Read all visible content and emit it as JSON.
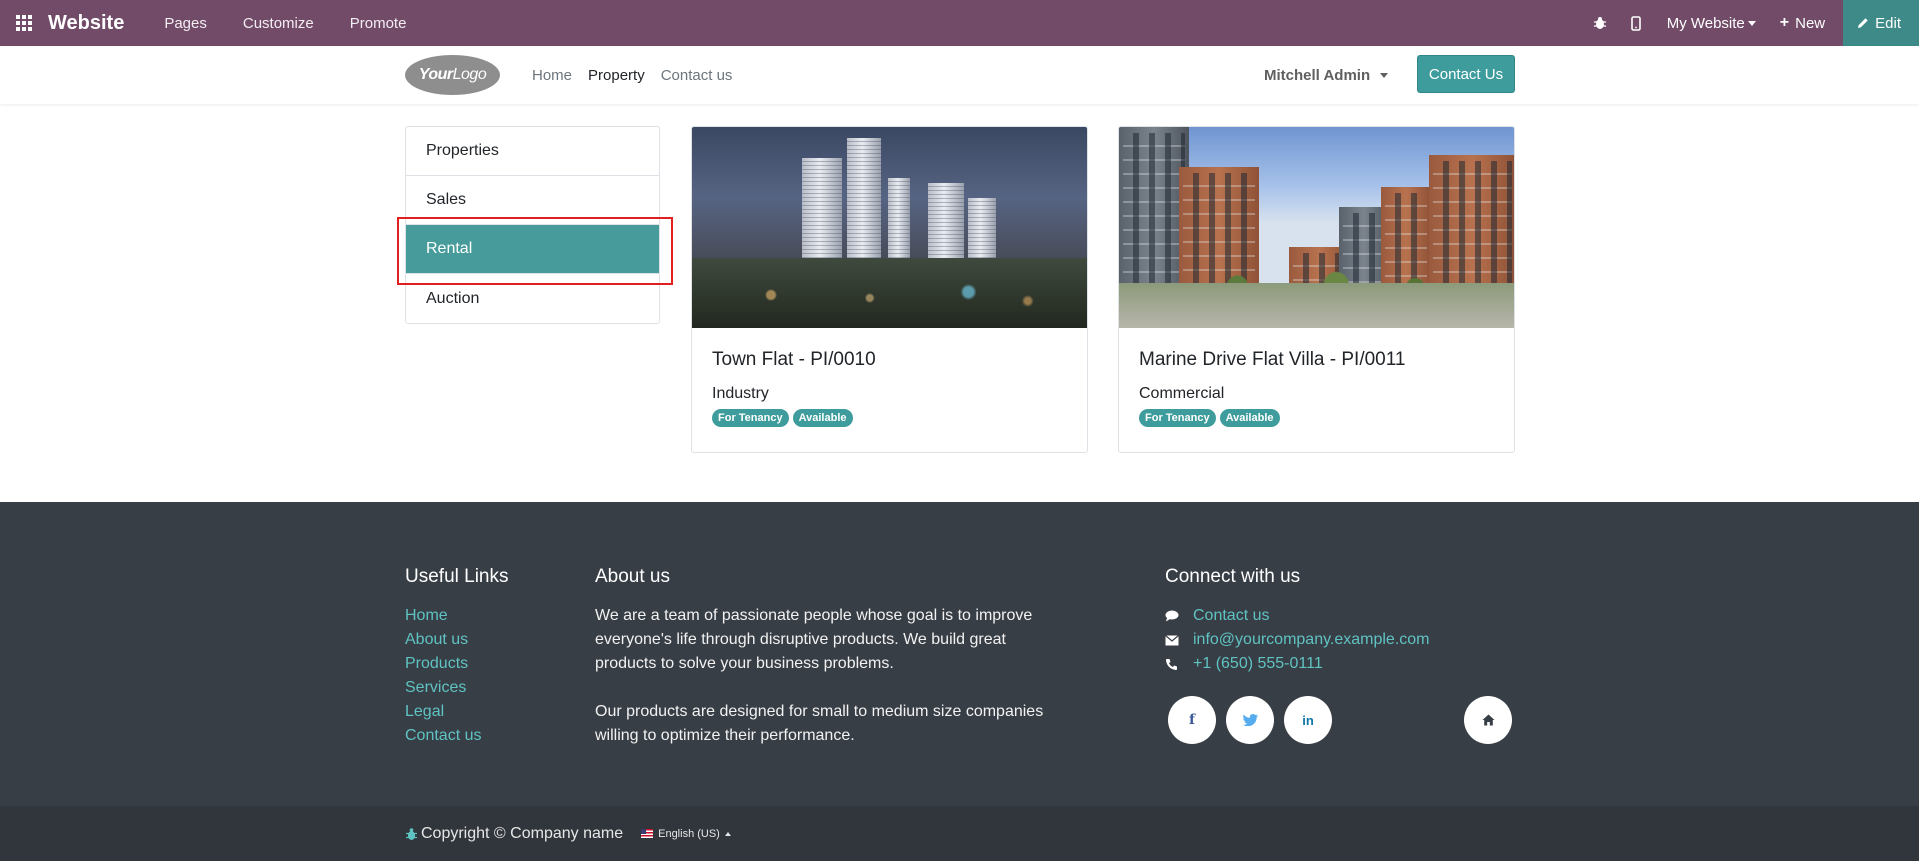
{
  "admin_bar": {
    "brand": "Website",
    "menu": [
      "Pages",
      "Customize",
      "Promote"
    ],
    "website_selector": "My Website",
    "new_label": "New",
    "edit_label": "Edit"
  },
  "site_header": {
    "logo_bold": "Your",
    "logo_light": "Logo",
    "nav": [
      "Home",
      "Property",
      "Contact us"
    ],
    "active_nav": "Property",
    "user": "Mitchell Admin",
    "contact_button": "Contact Us"
  },
  "sidebar": {
    "items": [
      "Properties",
      "Sales",
      "Rental",
      "Auction"
    ],
    "active": "Rental"
  },
  "cards": [
    {
      "title": "Town Flat - PI/0010",
      "type": "Industry",
      "badges": [
        "For Tenancy",
        "Available"
      ]
    },
    {
      "title": "Marine Drive Flat Villa - PI/0011",
      "type": "Commercial",
      "badges": [
        "For Tenancy",
        "Available"
      ]
    }
  ],
  "footer": {
    "useful_links_title": "Useful Links",
    "useful_links": [
      "Home",
      "About us",
      "Products",
      "Services",
      "Legal",
      "Contact us"
    ],
    "about_title": "About us",
    "about_p1": "We are a team of passionate people whose goal is to improve everyone's life through disruptive products. We build great products to solve your business problems.",
    "about_p2": "Our products are designed for small to medium size companies willing to optimize their performance.",
    "connect_title": "Connect with us",
    "contact_us": "Contact us",
    "email": "info@yourcompany.example.com",
    "phone": "+1 (650) 555-0111",
    "copyright": "Copyright © Company name",
    "language": "English (US)"
  },
  "colors": {
    "admin_bar": "#714B67",
    "accent": "#479b9b",
    "footer_bg": "#383e45",
    "highlight": "#e21f1f"
  }
}
